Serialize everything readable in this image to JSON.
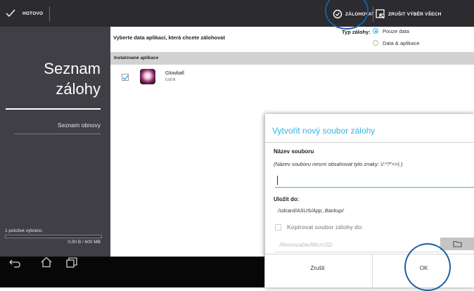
{
  "topbar": {
    "done_label": "HOTOVO",
    "backup_label": "ZÁLOHOVAT",
    "deselect_label": "ZRUŠIT VÝBĚR VŠECH"
  },
  "sidebar": {
    "title_line1": "Seznam",
    "title_line2": "zálohy",
    "restore_label": "Seznam obnovy",
    "selected_count": "1 položek vybráno",
    "size_info": "0,00 B / 600 MB"
  },
  "main": {
    "prompt": "Vyberte data aplikací, která chcete zálohovat",
    "backup_type_label": "Typ zálohy:",
    "options": [
      "Pouze data",
      "Data & aplikace"
    ],
    "installed_header": "Instalované aplikace",
    "apps": [
      {
        "name": "Glowball",
        "size": "0,00 B",
        "checked": true
      }
    ]
  },
  "dialog": {
    "title": "Vytvořit nový soubor zálohy",
    "filename_label": "Název souboru",
    "filename_hint": "(Název souboru nesmí obsahovat tyto znaky: \\/:*?\"<>| )",
    "filename_value": "",
    "save_label": "Uložit do:",
    "save_path": "/sdcard/ASUS/App_Backup/",
    "copy_label": "Kopírovat soubor zálohy do:",
    "copy_path_placeholder": "/Removable/MicroSD",
    "cancel_label": "Zrušit",
    "ok_label": "OK"
  },
  "colors": {
    "accent": "#33b5e5",
    "annotation": "#1a5da6",
    "sidebar_bg": "#3f3f45",
    "topbar_bg": "#2b2b30"
  }
}
